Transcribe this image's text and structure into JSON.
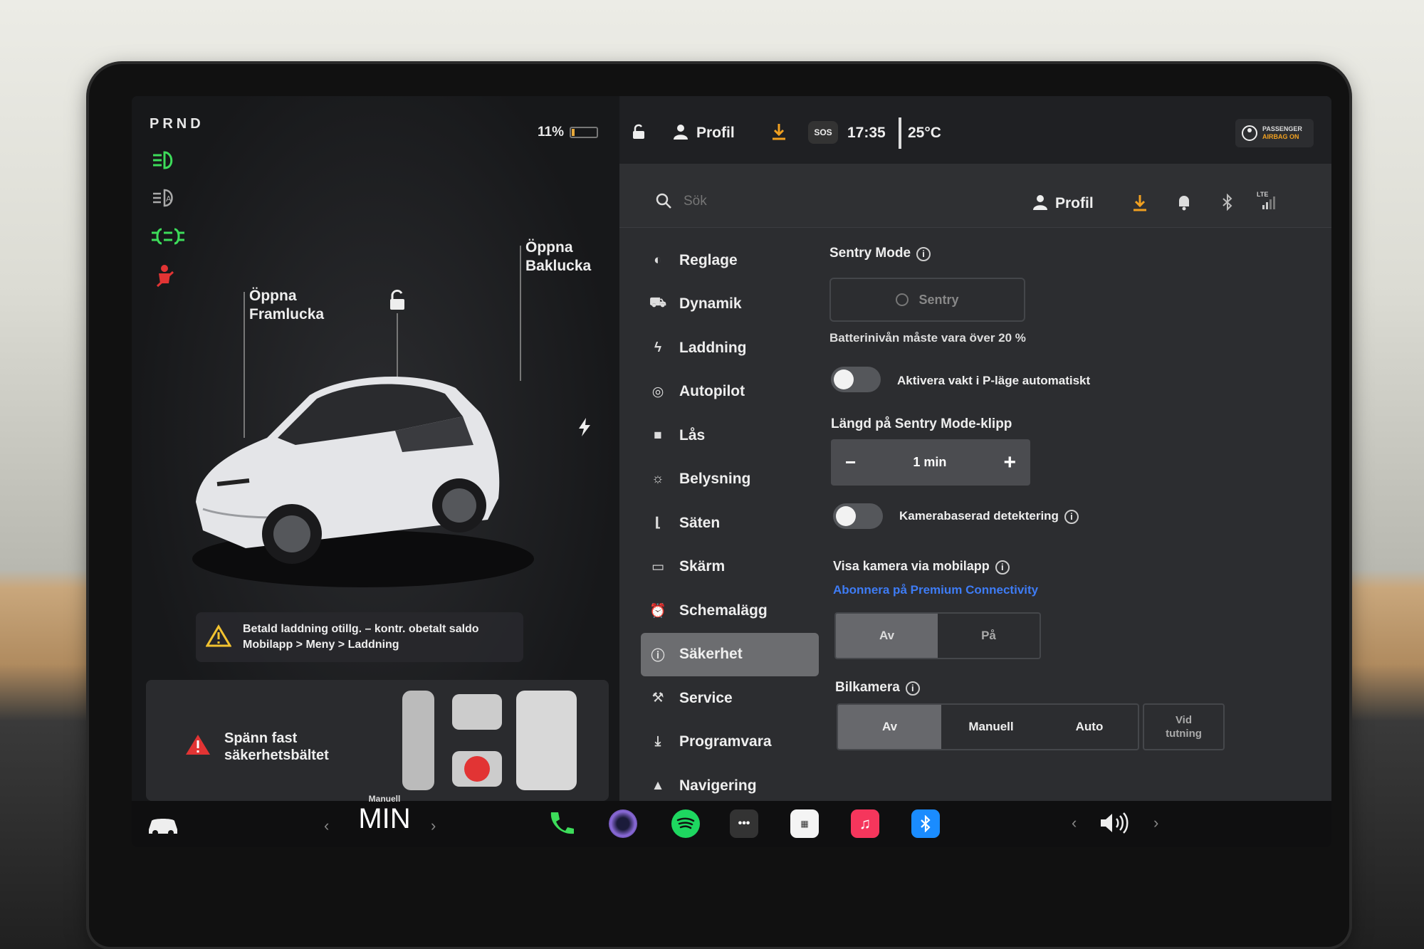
{
  "car": {
    "gear": "PRND",
    "battery_pct": "11%",
    "battery_level": 0.11,
    "open_frunk": "Öppna\nFramlucka",
    "open_frunk_l1": "Öppna",
    "open_frunk_l2": "Framlucka",
    "open_trunk_l1": "Öppna",
    "open_trunk_l2": "Baklucka",
    "notice_l1": "Betald laddning otillg. – kontr. obetalt saldo",
    "notice_l2": "Mobilapp > Meny > Laddning",
    "belt_l1": "Spänn fast",
    "belt_l2": "säkerhetsbältet"
  },
  "status": {
    "profile": "Profil",
    "time": "17:35",
    "temp": "25°C",
    "sos": "SOS",
    "airbag_l1": "PASSENGER",
    "airbag_l2": "AIRBAG ON"
  },
  "search": {
    "placeholder": "Sök",
    "profile": "Profil",
    "lte": "LTE"
  },
  "menu": [
    {
      "label": "Reglage",
      "icon": "toggle-icon"
    },
    {
      "label": "Dynamik",
      "icon": "car-icon"
    },
    {
      "label": "Laddning",
      "icon": "bolt-icon"
    },
    {
      "label": "Autopilot",
      "icon": "steering-wheel-icon"
    },
    {
      "label": "Lås",
      "icon": "lock-icon"
    },
    {
      "label": "Belysning",
      "icon": "sun-icon"
    },
    {
      "label": "Säten",
      "icon": "seat-icon"
    },
    {
      "label": "Skärm",
      "icon": "display-icon"
    },
    {
      "label": "Schemalägg",
      "icon": "alarm-clock-icon"
    },
    {
      "label": "Säkerhet",
      "icon": "shield-info-icon"
    },
    {
      "label": "Service",
      "icon": "wrench-icon"
    },
    {
      "label": "Programvara",
      "icon": "download-icon"
    },
    {
      "label": "Navigering",
      "icon": "navigation-icon"
    }
  ],
  "settings": {
    "sentry_title": "Sentry Mode",
    "sentry_button": "Sentry",
    "battery_req": "Batterinivån måste vara över 20 %",
    "auto_sentry": "Aktivera vakt i P-läge automatiskt",
    "clip_title": "Längd på Sentry Mode-klipp",
    "clip_value": "1 min",
    "camera_detect": "Kamerabaserad detektering",
    "mobile_cam_title": "Visa kamera via mobilapp",
    "premium_link": "Abonnera på Premium Connectivity",
    "mobile_cam_off": "Av",
    "mobile_cam_on": "På",
    "dashcam_title": "Bilkamera",
    "dashcam_off": "Av",
    "dashcam_manual": "Manuell",
    "dashcam_auto": "Auto",
    "dashcam_tap_l1": "Vid",
    "dashcam_tap_l2": "tutning"
  },
  "dock": {
    "climate_mode": "Manuell",
    "climate_value": "MIN"
  },
  "colors": {
    "accent_green": "#3ddc5a",
    "warning_red": "#e23434",
    "link_blue": "#3e7cf5",
    "download_orange": "#f0a020"
  }
}
